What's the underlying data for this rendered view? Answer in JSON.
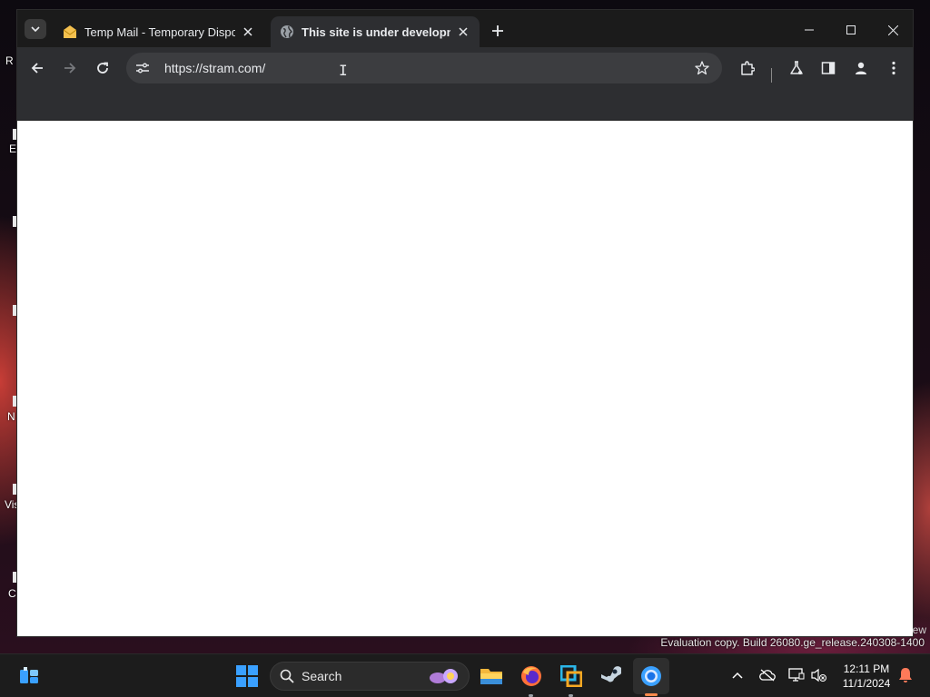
{
  "desktop": {
    "labels": [
      "R",
      "E",
      "N",
      "Vis",
      "C"
    ]
  },
  "browser": {
    "tabs": [
      {
        "title": "Temp Mail - Temporary Dispos",
        "favicon": "envelope-icon",
        "active": false
      },
      {
        "title": "This site is under development",
        "favicon": "globe-icon",
        "active": true
      }
    ],
    "tab_search_icon": "chevron-down-icon",
    "new_tab_icon": "plus-icon",
    "window_controls": [
      "minimize-icon",
      "maximize-icon",
      "close-icon"
    ],
    "toolbar": {
      "back_icon": "arrow-left-icon",
      "forward_icon": "arrow-right-icon",
      "reload_icon": "reload-icon",
      "url": "https://stram.com/",
      "site_info_icon": "tune-icon",
      "bookmark_icon": "star-icon",
      "extensions_icon": "puzzle-icon",
      "labs_icon": "flask-icon",
      "side_panel_icon": "side-panel-icon",
      "profile_icon": "person-icon",
      "menu_icon": "kebab-menu-icon"
    }
  },
  "watermark": {
    "partial": "ew",
    "text": "Evaluation copy. Build 26080.ge_release.240308-1400"
  },
  "taskbar": {
    "search_label": "Search",
    "apps": [
      "widgets-icon",
      "start-icon",
      "file-explorer-icon",
      "firefox-icon",
      "vmware-icon",
      "steam-icon",
      "chrome-icon"
    ],
    "time": "12:11 PM",
    "date": "11/1/2024",
    "colors": {
      "accent": "#ff8a4c",
      "start_blue": "#3aa0ff"
    }
  }
}
